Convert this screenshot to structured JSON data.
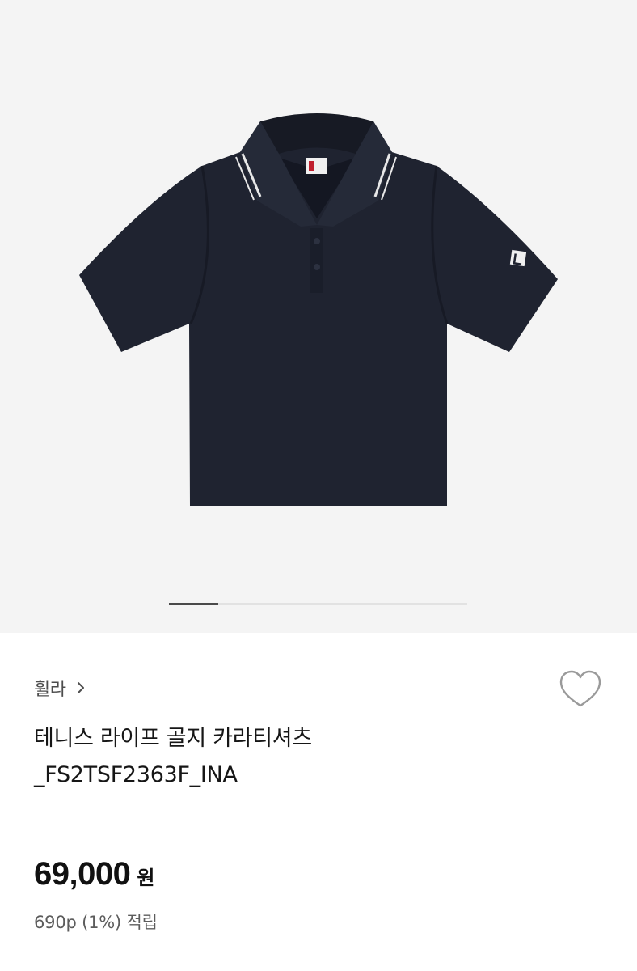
{
  "carousel": {
    "current_progress": 0.165
  },
  "product": {
    "brand": "휠라",
    "title": "테니스 라이프 골지 카라티셔츠\n_FS2TSF2363F_INA",
    "price": "69,000",
    "price_unit": "원",
    "points": "690p (1%) 적립"
  },
  "icons": {
    "brand_link": "chevron-right-icon",
    "wishlist": "heart-outline-icon"
  },
  "colors": {
    "hero_background": "#f4f4f4",
    "garment": "#1f2330",
    "progress_active": "#4a4a4a",
    "progress_track": "#e2e2e2"
  }
}
